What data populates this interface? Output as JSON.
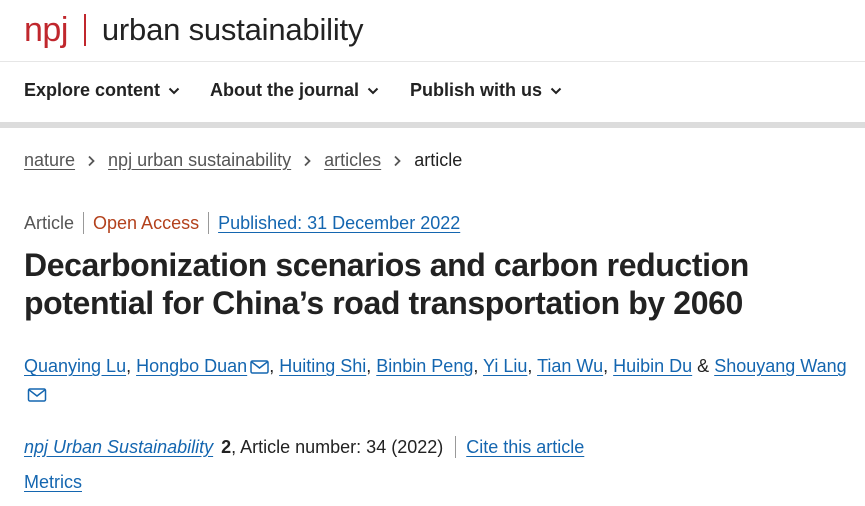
{
  "header": {
    "logo_brand": "npj",
    "logo_journal": "urban sustainability",
    "brand_color": "#c0272d"
  },
  "nav": {
    "items": [
      {
        "label": "Explore content",
        "icon": "chevron-down-icon"
      },
      {
        "label": "About the journal",
        "icon": "chevron-down-icon"
      },
      {
        "label": "Publish with us",
        "icon": "chevron-down-icon"
      }
    ]
  },
  "breadcrumb": {
    "items": [
      "nature",
      "npj urban sustainability",
      "articles"
    ],
    "current": "article",
    "separator_icon": "chevron-right-icon"
  },
  "article": {
    "type": "Article",
    "access": "Open Access",
    "published": "Published: 31 December 2022",
    "title_line1": "Decarbonization scenarios and carbon reduction",
    "title_line2": "potential for China’s road transportation by 2060",
    "authors": [
      {
        "name": "Quanying Lu",
        "sep": ", "
      },
      {
        "name": "Hongbo Duan",
        "sep": ", ",
        "mail": true
      },
      {
        "name": "Huiting Shi",
        "sep": ", "
      },
      {
        "name": "Binbin Peng",
        "sep": ", "
      },
      {
        "name": "Yi Liu",
        "sep": ", "
      },
      {
        "name": "Tian Wu",
        "sep": ", "
      },
      {
        "name": "Huibin Du",
        "sep": " & "
      },
      {
        "name": "Shouyang Wang",
        "sep": ""
      }
    ],
    "citation": {
      "journal": "npj Urban Sustainability",
      "volume": "2",
      "article_number": ", Article number: 34 (2022)",
      "cite_label": "Cite this article"
    },
    "metrics_label": "Metrics"
  },
  "colors": {
    "link": "#1466b0",
    "open_access": "#b3411c",
    "text": "#222222"
  }
}
